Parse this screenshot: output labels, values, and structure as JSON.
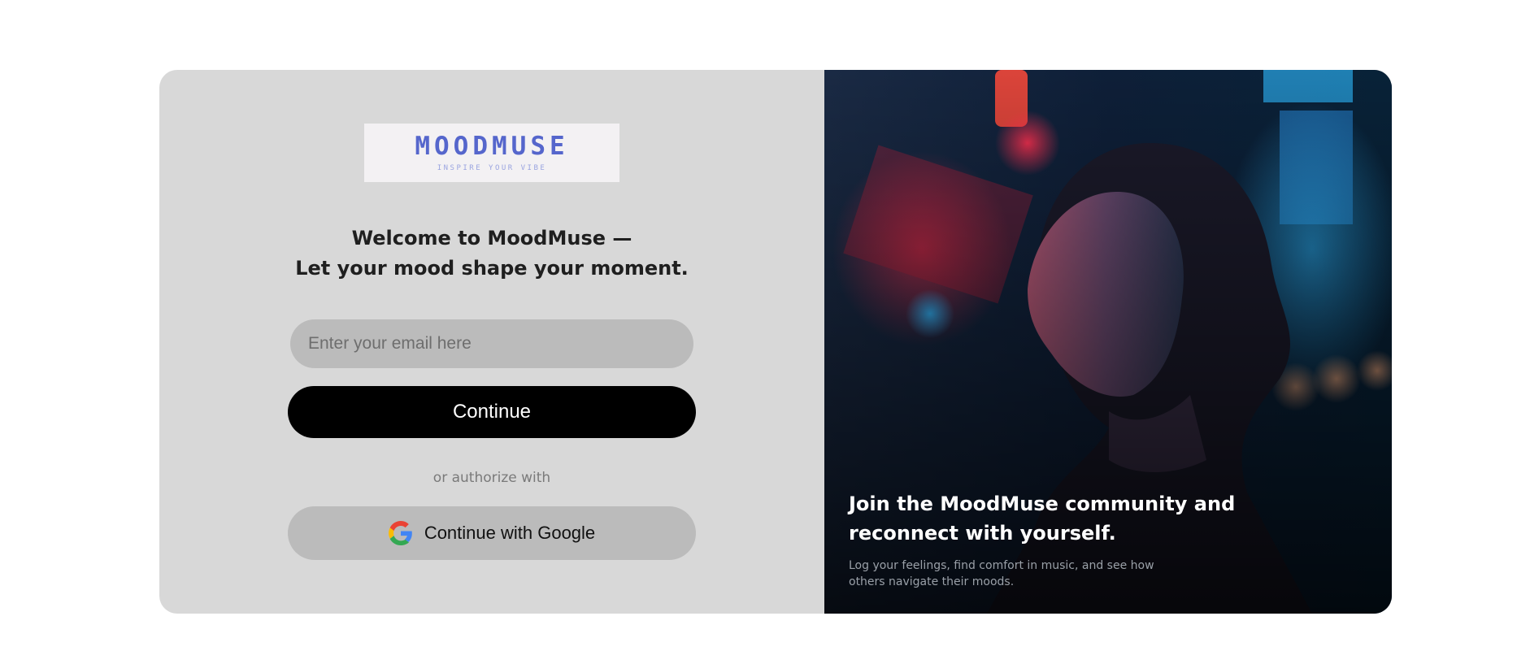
{
  "logo": {
    "title": "MOODMUSE",
    "tagline": "INSPIRE YOUR VIBE",
    "color": "#5566cc"
  },
  "welcome": {
    "line1": "Welcome to MoodMuse —",
    "line2": "Let your mood shape your moment."
  },
  "form": {
    "email_placeholder": "Enter your email here",
    "continue_label": "Continue",
    "or_text": "or authorize with",
    "google_label": "Continue with Google"
  },
  "hero": {
    "title": "Join the MoodMuse community and reconnect with yourself.",
    "subtitle": "Log your feelings, find comfort in music, and see how others navigate their moods.",
    "icon": "woman-neon-city-photo"
  },
  "colors": {
    "panel_bg": "#d8d8d8",
    "input_bg": "#bbbbbb",
    "primary_button": "#000000"
  }
}
